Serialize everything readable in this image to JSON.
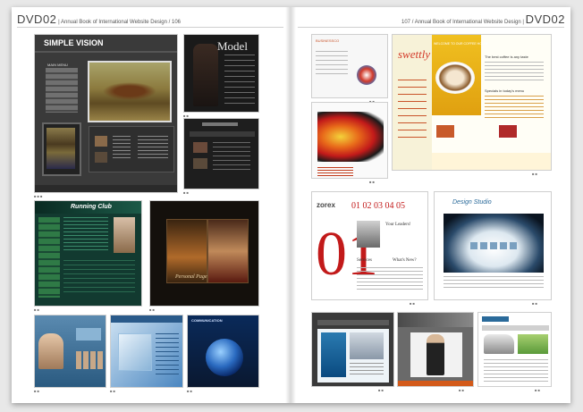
{
  "header_left": {
    "dvd": "DVD02",
    "title": "Annual Book of International Website Design",
    "page": "106"
  },
  "header_right": {
    "page": "107",
    "title": "Annual Book of International Website Design",
    "dvd": "DVD02"
  },
  "thumbs": {
    "simple_vision": {
      "title": "SIMPLE VISION",
      "menu": "MAIN MENU"
    },
    "model": {
      "title": "Model"
    },
    "running_club": {
      "title": "Running Club"
    },
    "personal_page": {
      "title": "Personal Page"
    },
    "communication": {
      "title": "COMMUNICATION"
    },
    "business": {
      "title": "BUSINESSCO"
    },
    "swettly": {
      "brand": "swettly",
      "welcome": "WELCOME TO OUR COFFEE HOUSE",
      "tagline": "The best coffee is any taste",
      "specials": "Specials in today's menu"
    },
    "zorex": {
      "logo": "zorex",
      "date": "01 02 03 04 05",
      "leaders": "Your Leaders!",
      "services": "Services",
      "whats_new": "What's New?"
    },
    "design_studio": {
      "title": "Design Studio"
    }
  }
}
